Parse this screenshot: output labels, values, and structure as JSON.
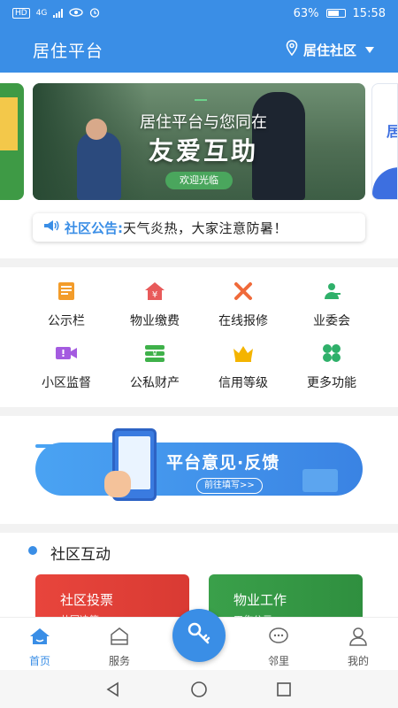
{
  "status_bar": {
    "left_label": "HD",
    "network": "4G",
    "battery_percent": "63%",
    "time": "15:58"
  },
  "header": {
    "title": "居住平台",
    "location": "居住社区"
  },
  "banner": {
    "line1": "居住平台与您同在",
    "line2": "友爱互助",
    "button": "欢迎光临",
    "right_peek_text": "居"
  },
  "notice": {
    "label": "社区公告:",
    "text": "天气炎热，大家注意防暑！"
  },
  "grid": [
    {
      "label": "公示栏",
      "icon": "bulletin-icon",
      "color": "#f39c2a"
    },
    {
      "label": "物业缴费",
      "icon": "house-yen-icon",
      "color": "#e85a5a"
    },
    {
      "label": "在线报修",
      "icon": "tools-icon",
      "color": "#f06a3a"
    },
    {
      "label": "业委会",
      "icon": "committee-icon",
      "color": "#2fb06a"
    },
    {
      "label": "小区监督",
      "icon": "camera-icon",
      "color": "#a45be0"
    },
    {
      "label": "公私财产",
      "icon": "money-stack-icon",
      "color": "#3fb14a"
    },
    {
      "label": "信用等级",
      "icon": "crown-icon",
      "color": "#f4b400"
    },
    {
      "label": "更多功能",
      "icon": "clover-icon",
      "color": "#2fb06a"
    }
  ],
  "feedback": {
    "title": "平台意见·反馈",
    "button": "前往填写>>"
  },
  "community": {
    "heading": "社区互动",
    "cards": [
      {
        "title": "社区投票",
        "subtitle": "共同决策"
      },
      {
        "title": "物业工作",
        "subtitle": "工作公示"
      }
    ]
  },
  "nav": [
    {
      "label": "首页",
      "icon": "home-icon",
      "active": true
    },
    {
      "label": "服务",
      "icon": "service-icon",
      "active": false
    },
    {
      "label": "邻里",
      "icon": "chat-icon",
      "active": false
    },
    {
      "label": "我的",
      "icon": "user-icon",
      "active": false
    }
  ],
  "colors": {
    "primary": "#3a8ee6",
    "background": "#f2f2f2"
  }
}
